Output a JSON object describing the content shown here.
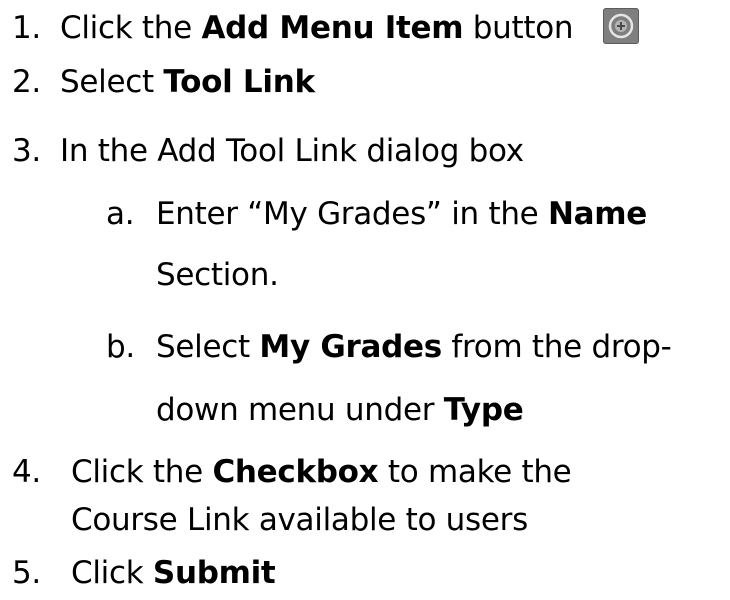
{
  "steps": [
    {
      "num": "1.",
      "pre": "Click the ",
      "bold": "Add Menu Item",
      "post": " button",
      "icon": "add-circle-icon"
    },
    {
      "num": "2.",
      "pre": "Select ",
      "bold": "Tool Link"
    },
    {
      "num": "3.",
      "pre": "In the Add Tool Link dialog box"
    },
    {
      "num": "a.",
      "pre": "Enter “My Grades” in the ",
      "bold": "Name",
      "cont": "Section."
    },
    {
      "num": "b.",
      "pre": "Select ",
      "bold": "My Grades",
      "post": " from the drop-",
      "cont_pre": "down menu under ",
      "cont_bold": "Type"
    },
    {
      "num": "4.",
      "pre": "Click the ",
      "bold": "Checkbox",
      "post": " to make the",
      "cont": "Course Link available to users"
    },
    {
      "num": "5.",
      "pre": "Click ",
      "bold": "Submit"
    }
  ],
  "colors": {
    "text": "#000000",
    "icon_bg": "#7f7f7f",
    "icon_ring": "#e6e6e6"
  }
}
